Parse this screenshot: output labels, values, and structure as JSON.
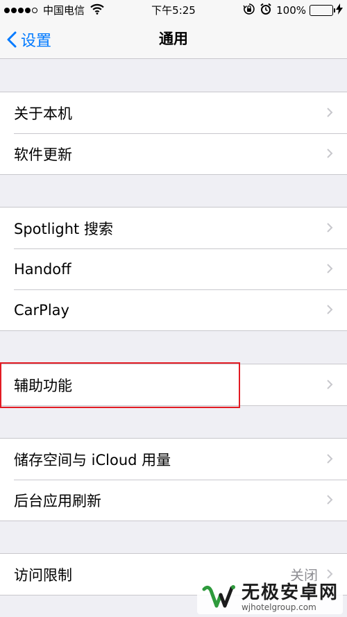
{
  "status_bar": {
    "carrier": "中国电信",
    "time": "下午5:25",
    "battery_percent": "100%",
    "battery_level": 1.0,
    "signal_bars": 4,
    "signal_max": 5
  },
  "nav": {
    "back_label": "设置",
    "title": "通用"
  },
  "groups": [
    {
      "rows": [
        {
          "label": "关于本机"
        },
        {
          "label": "软件更新"
        }
      ]
    },
    {
      "rows": [
        {
          "label": "Spotlight 搜索"
        },
        {
          "label": "Handoff"
        },
        {
          "label": "CarPlay"
        }
      ]
    },
    {
      "rows": [
        {
          "label": "辅助功能"
        }
      ]
    },
    {
      "rows": [
        {
          "label": "储存空间与 iCloud 用量"
        },
        {
          "label": "后台应用刷新"
        }
      ]
    },
    {
      "rows": [
        {
          "label": "访问限制",
          "value": "关闭"
        }
      ]
    }
  ],
  "watermark": {
    "title": "无极安卓网",
    "url": "wjhotelgroup.com"
  },
  "colors": {
    "accent": "#007aff",
    "highlight": "#e21b23",
    "battery": "#4cd964",
    "background": "#efeff4"
  },
  "icons": [
    "signal-dots",
    "wifi-icon",
    "lock-rotation-icon",
    "alarm-icon",
    "battery-icon",
    "charging-bolt-icon",
    "back-chevron-icon",
    "chevron-right-icon"
  ]
}
